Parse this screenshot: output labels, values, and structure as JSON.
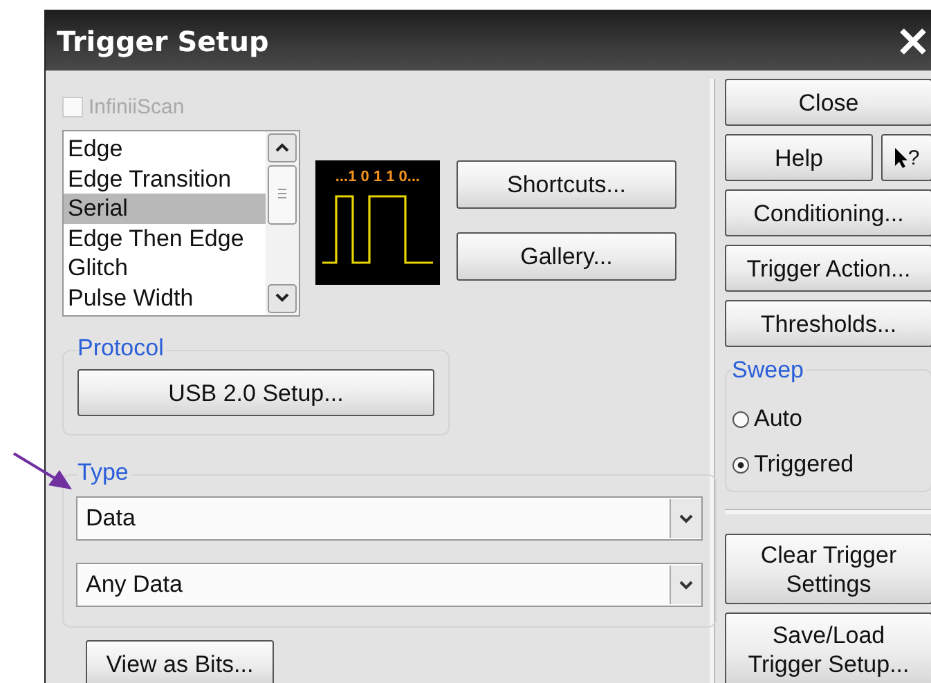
{
  "window": {
    "title": "Trigger Setup"
  },
  "infiniiscan": {
    "label": "InfiniiScan",
    "checked": false,
    "disabled": true
  },
  "trigger_types": [
    {
      "label": "Edge",
      "selected": false
    },
    {
      "label": "Edge Transition",
      "selected": false
    },
    {
      "label": "Serial",
      "selected": true
    },
    {
      "label": "Edge Then Edge",
      "selected": false
    },
    {
      "label": "Glitch",
      "selected": false
    },
    {
      "label": "Pulse Width",
      "selected": false
    }
  ],
  "preview": {
    "bits": "...1 0 1 1 0..."
  },
  "preview_buttons": [
    "Shortcuts...",
    "Gallery..."
  ],
  "protocol": {
    "label": "Protocol",
    "button": "USB 2.0 Setup..."
  },
  "type": {
    "label": "Type",
    "selects": [
      {
        "value": "Data"
      },
      {
        "value": "Any Data"
      }
    ]
  },
  "view_bits_button": "View as Bits...",
  "right_panel": {
    "close": "Close",
    "help": "Help",
    "whats_this": "?",
    "buttons": [
      "Conditioning...",
      "Trigger Action...",
      "Thresholds..."
    ],
    "sweep": {
      "label": "Sweep",
      "options": [
        {
          "label": "Auto",
          "selected": false
        },
        {
          "label": "Triggered",
          "selected": true
        }
      ]
    },
    "bottom_buttons": [
      {
        "lines": [
          "Clear Trigger",
          "Settings"
        ]
      },
      {
        "lines": [
          "Save/Load",
          "Trigger Setup..."
        ]
      }
    ]
  }
}
